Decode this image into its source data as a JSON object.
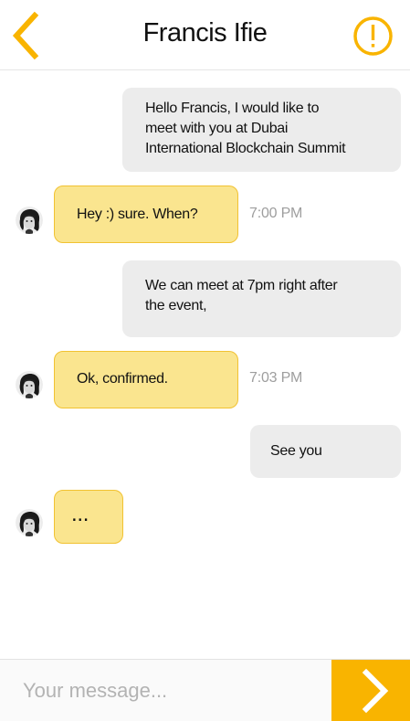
{
  "header": {
    "title": "Francis Ifie",
    "accent_color": "#F9B400",
    "back_icon": "chevron-left-icon",
    "info_icon": "exclamation-circle-icon"
  },
  "messages": [
    {
      "direction": "outgoing",
      "lines": [
        "Hello Francis, I would like to",
        "meet with you at Dubai",
        "International Blockchain Summit"
      ]
    },
    {
      "direction": "incoming",
      "text": "Hey :) sure. When?",
      "time": "7:00 PM"
    },
    {
      "direction": "outgoing",
      "lines": [
        "We can meet at 7pm right after",
        "the event,"
      ]
    },
    {
      "direction": "incoming",
      "text": "Ok, confirmed.",
      "time": "7:03 PM"
    },
    {
      "direction": "outgoing",
      "text": "See you"
    },
    {
      "direction": "incoming",
      "text": "..."
    }
  ],
  "composer": {
    "placeholder": "Your message...",
    "send_icon": "chevron-right-icon"
  }
}
